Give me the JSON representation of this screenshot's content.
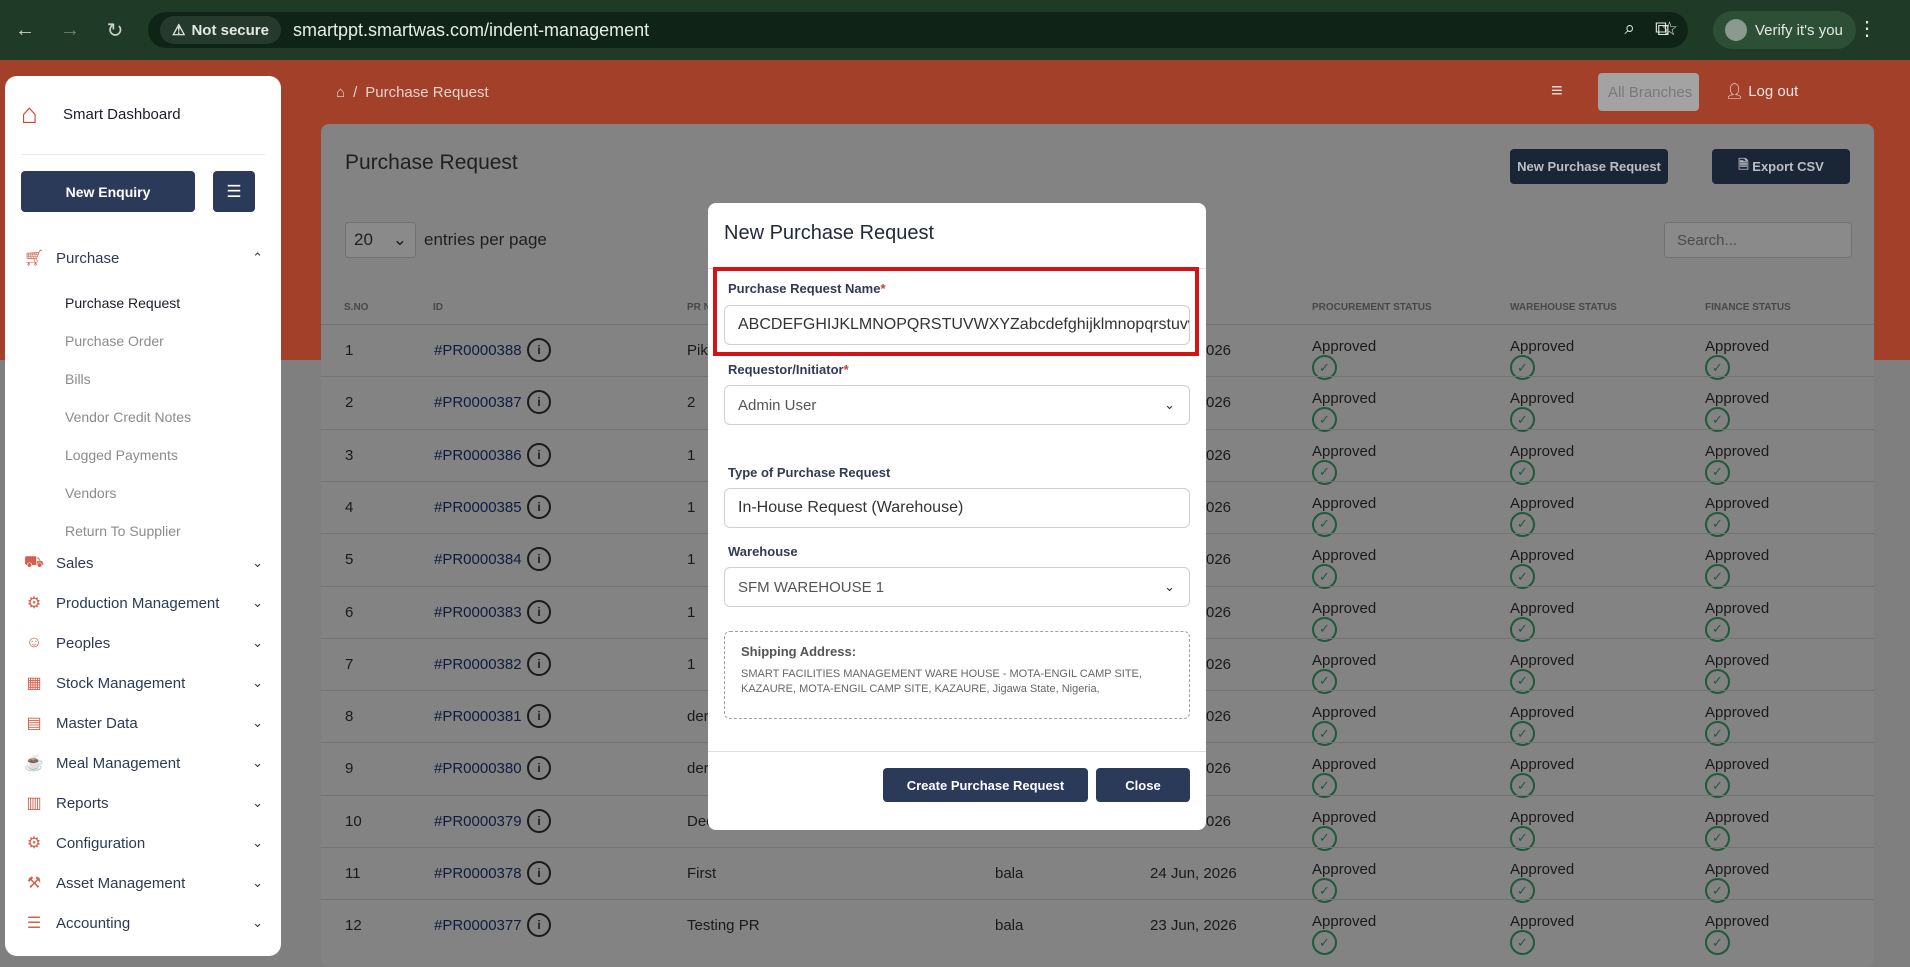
{
  "browser": {
    "not_secure": "Not secure",
    "url": "smartppt.smartwas.com/indent-management",
    "verify": "Verify it's you"
  },
  "topbar": {
    "breadcrumb_sep": "/",
    "breadcrumb": "Purchase Request",
    "branch": "All Branches",
    "logout": "Log out"
  },
  "sidebar": {
    "brand": "Smart Dashboard",
    "new_enquiry": "New Enquiry",
    "purchase": "Purchase",
    "sub": [
      "Purchase Request",
      "Purchase Order",
      "Bills",
      "Vendor Credit Notes",
      "Logged Payments",
      "Vendors",
      "Return To Supplier"
    ],
    "items": [
      "Sales",
      "Production Management",
      "Peoples",
      "Stock Management",
      "Master Data",
      "Meal Management",
      "Reports",
      "Configuration",
      "Asset Management",
      "Accounting"
    ]
  },
  "page": {
    "title": "Purchase Request",
    "new_btn": "New Purchase Request",
    "export_btn": "Export CSV",
    "entries_value": "20",
    "entries_label": "entries per page",
    "search_placeholder": "Search...",
    "columns": [
      "S.NO",
      "ID",
      "PR N",
      "PROCUREMENT STATUS",
      "WAREHOUSE STATUS",
      "FINANCE STATUS"
    ],
    "rows": [
      {
        "sno": "1",
        "id": "#PR0000388",
        "name": "Pik",
        "by": "",
        "date": "026",
        "p": "Approved",
        "w": "Approved",
        "f": "Approved"
      },
      {
        "sno": "2",
        "id": "#PR0000387",
        "name": "2",
        "by": "",
        "date": "026",
        "p": "Approved",
        "w": "Approved",
        "f": "Approved"
      },
      {
        "sno": "3",
        "id": "#PR0000386",
        "name": "1",
        "by": "",
        "date": "026",
        "p": "Approved",
        "w": "Approved",
        "f": "Approved"
      },
      {
        "sno": "4",
        "id": "#PR0000385",
        "name": "1",
        "by": "",
        "date": "026",
        "p": "Approved",
        "w": "Approved",
        "f": "Approved"
      },
      {
        "sno": "5",
        "id": "#PR0000384",
        "name": "1",
        "by": "",
        "date": "026",
        "p": "Approved",
        "w": "Approved",
        "f": "Approved"
      },
      {
        "sno": "6",
        "id": "#PR0000383",
        "name": "1",
        "by": "",
        "date": "026",
        "p": "Approved",
        "w": "Approved",
        "f": "Approved"
      },
      {
        "sno": "7",
        "id": "#PR0000382",
        "name": "1",
        "by": "",
        "date": "026",
        "p": "Approved",
        "w": "Approved",
        "f": "Approved"
      },
      {
        "sno": "8",
        "id": "#PR0000381",
        "name": "der",
        "by": "",
        "date": "026",
        "p": "Approved",
        "w": "Approved",
        "f": "Approved"
      },
      {
        "sno": "9",
        "id": "#PR0000380",
        "name": "der",
        "by": "",
        "date": "026",
        "p": "Approved",
        "w": "Approved",
        "f": "Approved"
      },
      {
        "sno": "10",
        "id": "#PR0000379",
        "name": "Dec",
        "by": "",
        "date": "026",
        "p": "Approved",
        "w": "Approved",
        "f": "Approved"
      },
      {
        "sno": "11",
        "id": "#PR0000378",
        "name": "First",
        "by": "bala",
        "date": "24 Jun, 2026",
        "p": "Approved",
        "w": "Approved",
        "f": "Approved"
      },
      {
        "sno": "12",
        "id": "#PR0000377",
        "name": "Testing PR",
        "by": "bala",
        "date": "23 Jun, 2026",
        "p": "Approved",
        "w": "Approved",
        "f": "Approved"
      }
    ]
  },
  "modal": {
    "title": "New Purchase Request",
    "name_label": "Purchase Request Name",
    "req_mark": "*",
    "name_value": "ABCDEFGHIJKLMNOPQRSTUVWXYZabcdefghijklmnopqrstuvw",
    "requestor_label": "Requestor/Initiator",
    "requestor_value": "Admin User",
    "type_label": "Type of Purchase Request",
    "type_value": "In-House Request (Warehouse)",
    "warehouse_label": "Warehouse",
    "warehouse_value": "SFM WAREHOUSE 1",
    "ship_title": "Shipping Address:",
    "ship_address": "SMART FACILITIES MANAGEMENT WARE HOUSE - MOTA-ENGIL CAMP SITE, KAZAURE, MOTA-ENGIL CAMP SITE, KAZAURE, Jigawa State, Nigeria,",
    "create": "Create Purchase Request",
    "close": "Close"
  }
}
